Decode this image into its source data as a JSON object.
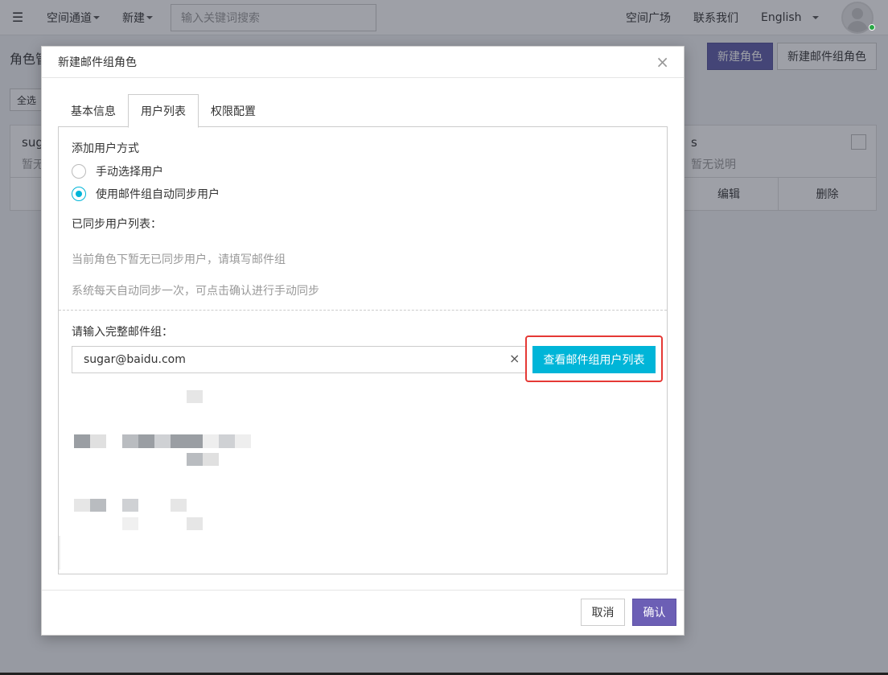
{
  "topbar": {
    "nav_space": "空间通道",
    "nav_new": "新建",
    "search_placeholder": "输入关键词搜索",
    "space_square": "空间广场",
    "contact_us": "联系我们",
    "language": "English"
  },
  "background": {
    "page_title": "角色管",
    "new_role_button": "新建角色",
    "new_mail_group_role_button": "新建邮件组角色",
    "select_all": "全选",
    "card_left": {
      "name": "sug",
      "desc": "暂无"
    },
    "card_right": {
      "name": "s",
      "desc": "暂无说明",
      "edit": "编辑",
      "delete": "删除"
    }
  },
  "modal": {
    "title": "新建邮件组角色",
    "tabs": [
      {
        "label": "基本信息"
      },
      {
        "label": "用户列表"
      },
      {
        "label": "权限配置"
      }
    ],
    "add_method_label": "添加用户方式",
    "radio_manual": "手动选择用户",
    "radio_auto": "使用邮件组自动同步用户",
    "synced_list_label": "已同步用户列表：",
    "hint_no_users": "当前角色下暂无已同步用户，请填写邮件组",
    "hint_daily_sync": "系统每天自动同步一次，可点击确认进行手动同步",
    "mail_group_label": "请输入完整邮件组：",
    "mail_group_value": "sugar@baidu.com",
    "view_list_button": "查看邮件组用户列表",
    "cancel_button": "取消",
    "confirm_button": "确认"
  },
  "colors": {
    "primary": "#5c5aa8",
    "info": "#00b5d8",
    "highlight": "#e53935"
  }
}
